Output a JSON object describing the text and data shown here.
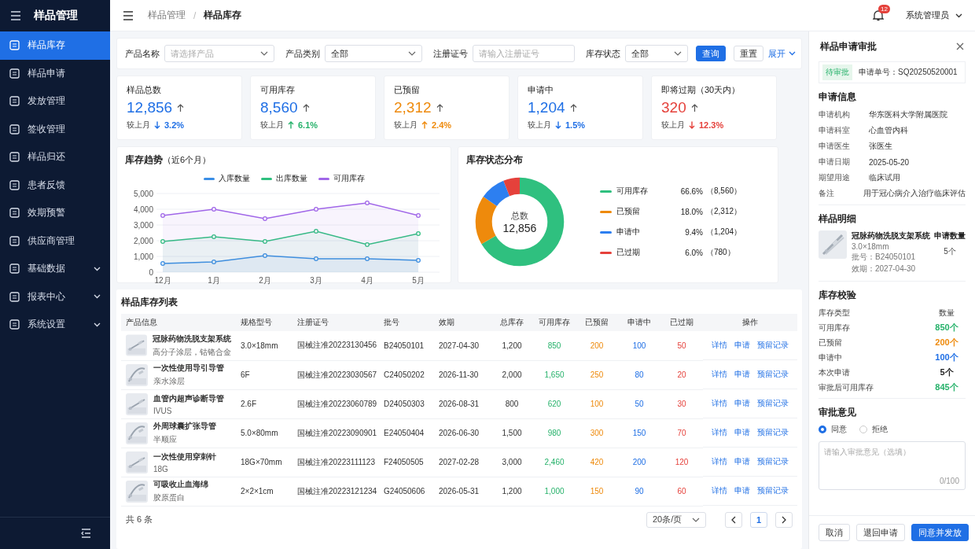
{
  "app": {
    "title": "样品管理"
  },
  "sidebar": {
    "items": [
      {
        "label": "样品库存",
        "selected": true,
        "expandable": false
      },
      {
        "label": "样品申请",
        "selected": false,
        "expandable": false
      },
      {
        "label": "发放管理",
        "selected": false,
        "expandable": false
      },
      {
        "label": "签收管理",
        "selected": false,
        "expandable": false
      },
      {
        "label": "样品归还",
        "selected": false,
        "expandable": false
      },
      {
        "label": "患者反馈",
        "selected": false,
        "expandable": false
      },
      {
        "label": "效期预警",
        "selected": false,
        "expandable": false
      },
      {
        "label": "供应商管理",
        "selected": false,
        "expandable": false
      },
      {
        "label": "基础数据",
        "selected": false,
        "expandable": true
      },
      {
        "label": "报表中心",
        "selected": false,
        "expandable": true
      },
      {
        "label": "系统设置",
        "selected": false,
        "expandable": true
      }
    ]
  },
  "header": {
    "breadcrumb": [
      "样品管理",
      "样品库存"
    ],
    "separator": "/",
    "notifications": "12",
    "user": "系统管理员"
  },
  "filters": {
    "fields": [
      {
        "label": "产品名称",
        "kind": "select",
        "placeholder": "请选择产品"
      },
      {
        "label": "产品类别",
        "kind": "select",
        "value": "全部"
      },
      {
        "label": "注册证号",
        "kind": "input",
        "placeholder": "请输入注册证号"
      },
      {
        "label": "库存状态",
        "kind": "select",
        "value": "全部"
      }
    ],
    "search": "查询",
    "reset": "重置",
    "expand": "展开"
  },
  "stats": [
    {
      "label": "样品总数",
      "value": "12,856",
      "color": "#1f6fe5",
      "compare": "较上月",
      "change": {
        "text": "3.2%",
        "color": "#1f6fe5",
        "up": false
      }
    },
    {
      "label": "可用库存",
      "value": "8,560",
      "color": "#1f6fe5",
      "compare": "较上月",
      "change": {
        "text": "6.1%",
        "color": "#27b26b",
        "up": true
      }
    },
    {
      "label": "已预留",
      "value": "2,312",
      "color": "#ee8a0c",
      "compare": "较上月",
      "change": {
        "text": "2.4%",
        "color": "#ee8a0c",
        "up": true
      }
    },
    {
      "label": "申请中",
      "value": "1,204",
      "color": "#1f6fe5",
      "compare": "较上月",
      "change": {
        "text": "1.5%",
        "color": "#1f6fe5",
        "up": false
      }
    },
    {
      "label": "即将过期（30天内）",
      "value": "320",
      "color": "#e5413b",
      "compare": "较上月",
      "change": {
        "text": "12.3%",
        "color": "#e5413b",
        "up": false
      }
    }
  ],
  "trend_chart": {
    "title": "库存趋势",
    "subtitle": "（近6个月）",
    "chart_data": {
      "type": "area",
      "stacked": false,
      "grid": true,
      "categories": [
        "12月",
        "1月",
        "2月",
        "3月",
        "4月",
        "5月"
      ],
      "ylim": [
        0,
        5000
      ],
      "yticks": [
        {
          "value": 0,
          "label": "0"
        },
        {
          "value": 1000,
          "label": "1,000"
        },
        {
          "value": 2000,
          "label": "2,000"
        },
        {
          "value": 3000,
          "label": "3,000"
        },
        {
          "value": 4000,
          "label": "4,000"
        },
        {
          "value": 5000,
          "label": "5,000"
        }
      ],
      "series": [
        {
          "name": "入库数量",
          "color": "#3a8ee6",
          "marker": true,
          "values": [
            550,
            650,
            1050,
            850,
            850,
            750
          ]
        },
        {
          "name": "出库数量",
          "color": "#2fc07f",
          "marker": true,
          "values": [
            1950,
            2250,
            1950,
            2600,
            1750,
            2450
          ]
        },
        {
          "name": "可用库存",
          "color": "#a066e8",
          "marker": true,
          "values": [
            3600,
            4000,
            3400,
            4000,
            4400,
            3600
          ]
        }
      ]
    }
  },
  "status_chart": {
    "title": "库存状态分布",
    "center_label": "总数",
    "center_value": "12,856",
    "chart_data": {
      "type": "donut",
      "categories": [
        "可用库存",
        "已预留",
        "申请中",
        "已过期"
      ],
      "series": [
        {
          "values": [
            66.6,
            18.0,
            9.4,
            6.0
          ]
        }
      ],
      "colors": [
        "#2fc07f",
        "#ee8a0c",
        "#2d7ff0",
        "#e5413b"
      ]
    },
    "legend": [
      {
        "percent": "66.6%",
        "count": "（8,560）"
      },
      {
        "percent": "18.0%",
        "count": "（2,312）"
      },
      {
        "percent": "9.4%",
        "count": "（1,204）"
      },
      {
        "percent": "6.0%",
        "count": "（780）"
      }
    ]
  },
  "table": {
    "title": "样品库存列表",
    "columns": [
      "产品信息",
      "规格型号",
      "注册证号",
      "批号",
      "效期",
      "总库存",
      "可用库存",
      "已预留",
      "申请中",
      "已过期",
      "操作"
    ],
    "rows": [
      {
        "name": "冠脉药物洗脱支架系统",
        "sub": "高分子涂层，钴铬合金",
        "spec": "3.0×18mm",
        "reg": "国械注准20223130456",
        "batch": "B24050101",
        "expiry": "2027-04-30",
        "total": "1,200",
        "available": "850",
        "reserved": "200",
        "pending": "100",
        "expired": "50",
        "actions": [
          "详情",
          "申请",
          "预留记录"
        ]
      },
      {
        "name": "一次性使用导引导管",
        "sub": "亲水涂层",
        "spec": "6F",
        "reg": "国械注准20223030567",
        "batch": "C24050202",
        "expiry": "2026-11-30",
        "total": "2,000",
        "available": "1,650",
        "reserved": "250",
        "pending": "80",
        "expired": "20",
        "actions": [
          "详情",
          "申请",
          "预留记录"
        ]
      },
      {
        "name": "血管内超声诊断导管",
        "sub": "IVUS",
        "spec": "2.6F",
        "reg": "国械注准20223060789",
        "batch": "D24050303",
        "expiry": "2026-08-31",
        "total": "800",
        "available": "620",
        "reserved": "100",
        "pending": "50",
        "expired": "30",
        "actions": [
          "详情",
          "申请",
          "预留记录"
        ]
      },
      {
        "name": "外周球囊扩张导管",
        "sub": "半顺应",
        "spec": "5.0×80mm",
        "reg": "国械注准20223090901",
        "batch": "E24050404",
        "expiry": "2026-06-30",
        "total": "1,500",
        "available": "980",
        "reserved": "300",
        "pending": "150",
        "expired": "70",
        "actions": [
          "详情",
          "申请",
          "预留记录"
        ]
      },
      {
        "name": "一次性使用穿刺针",
        "sub": "18G",
        "spec": "18G×70mm",
        "reg": "国械注准20223111123",
        "batch": "F24050505",
        "expiry": "2027-02-28",
        "total": "3,000",
        "available": "2,460",
        "reserved": "420",
        "pending": "200",
        "expired": "120",
        "actions": [
          "详情",
          "申请",
          "预留记录"
        ]
      },
      {
        "name": "可吸收止血海绵",
        "sub": "胶原蛋白",
        "spec": "2×2×1cm",
        "reg": "国械注准20223121234",
        "batch": "G24050606",
        "expiry": "2026-05-31",
        "total": "1,200",
        "available": "1,000",
        "reserved": "150",
        "pending": "90",
        "expired": "60",
        "actions": [
          "详情",
          "申请",
          "预留记录"
        ]
      }
    ]
  },
  "pagination": {
    "total": "共 6 条",
    "page_size": "20条/页",
    "pages": [
      {
        "label": "1",
        "selected": true
      }
    ]
  },
  "panel": {
    "title": "样品申请审批",
    "status": "待审批",
    "order": "申请单号：SQ20250520001",
    "info_title": "申请信息",
    "info": [
      {
        "label": "申请机构",
        "value": "华东医科大学附属医院"
      },
      {
        "label": "申请科室",
        "value": "心血管内科"
      },
      {
        "label": "申请医生",
        "value": "张医生"
      },
      {
        "label": "申请日期",
        "value": "2025-05-20"
      },
      {
        "label": "期望用途",
        "value": "临床试用"
      },
      {
        "label": "备注",
        "value": "用于冠心病介入治疗临床评估"
      }
    ],
    "detail_title": "样品明细",
    "item": {
      "name": "冠脉药物洗脱支架系统",
      "spec": "3.0×18mm",
      "batch": "批号：B24050101",
      "expiry": "效期：2027-04-30",
      "qty_label": "申请数量",
      "qty": "5个"
    },
    "check_title": "库存校验",
    "check_head": [
      "库存类型",
      "数量"
    ],
    "check": [
      {
        "label": "可用库存",
        "value": "850个",
        "color": "#27b26b"
      },
      {
        "label": "已预留",
        "value": "200个",
        "color": "#ee8a0c"
      },
      {
        "label": "申请中",
        "value": "100个",
        "color": "#1f6fe5"
      },
      {
        "label": "本次申请",
        "value": "5个",
        "color": "#222222"
      },
      {
        "label": "审批后可用库存",
        "value": "845个",
        "color": "#27b26b"
      }
    ],
    "opinion_title": "审批意见",
    "options": [
      {
        "label": "同意",
        "selected": true
      },
      {
        "label": "拒绝",
        "selected": false
      }
    ],
    "comment_placeholder": "请输入审批意见（选填）",
    "counter": "0/100",
    "buttons": [
      {
        "label": "取消",
        "kind": "default"
      },
      {
        "label": "退回申请",
        "kind": "default"
      },
      {
        "label": "同意并发放",
        "kind": "primary"
      }
    ]
  }
}
